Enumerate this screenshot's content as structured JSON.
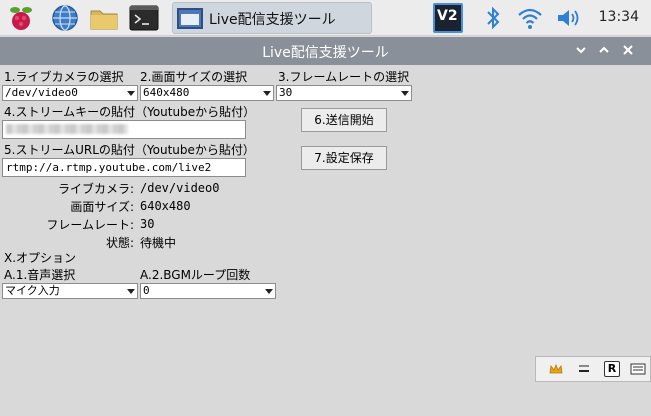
{
  "taskbar": {
    "task_title": "Live配信支援ツール",
    "clock": "13:34",
    "vnc_label": "V2"
  },
  "window": {
    "title": "Live配信支援ツール"
  },
  "form": {
    "camera": {
      "label": "1.ライブカメラの選択",
      "value": "/dev/video0"
    },
    "resolution": {
      "label": "2.画面サイズの選択",
      "value": "640x480"
    },
    "framerate": {
      "label": "3.フレームレートの選択",
      "value": "30"
    },
    "stream_key_label": "4.ストリームキーの貼付（Youtubeから貼付）",
    "stream_url": {
      "label": "5.ストリームURLの貼付（Youtubeから貼付）",
      "value": "rtmp://a.rtmp.youtube.com/live2"
    },
    "start_button": "6.送信開始",
    "save_button": "7.設定保存"
  },
  "status": {
    "camera_label": "ライブカメラ:",
    "camera_value": "/dev/video0",
    "size_label": "画面サイズ:",
    "size_value": "640x480",
    "fps_label": "フレームレート:",
    "fps_value": "30",
    "state_label": "状態:",
    "state_value": "待機中"
  },
  "options": {
    "heading": "X.オプション",
    "audio": {
      "label": "A.1.音声選択",
      "value": "マイク入力"
    },
    "bgm_loop": {
      "label": "A.2.BGMループ回数",
      "value": "0"
    }
  },
  "colors": {
    "titlebar": "#8a9099",
    "body_bg": "#d9d9d9"
  }
}
